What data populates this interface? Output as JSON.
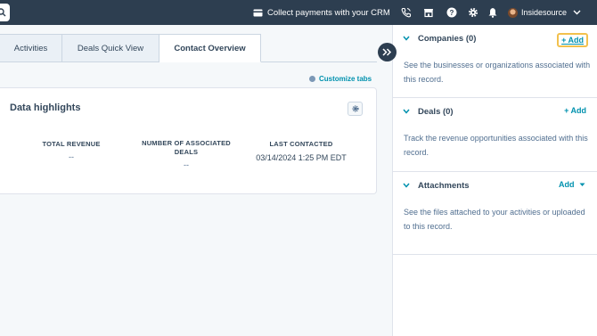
{
  "topbar": {
    "collect_label": "Collect payments with your CRM",
    "account_name": "Insidesource",
    "icons": [
      "search-icon",
      "credit-card-icon",
      "phone-icon",
      "marketplace-icon",
      "help-icon",
      "settings-icon",
      "bell-icon",
      "chevron-down-icon"
    ]
  },
  "tabs": [
    {
      "label": "Activities"
    },
    {
      "label": "Deals Quick View"
    },
    {
      "label": "Contact Overview",
      "active": true
    }
  ],
  "customize_label": "Customize tabs",
  "highlights": {
    "title": "Data highlights",
    "stats": [
      {
        "label": "TOTAL REVENUE",
        "value": "--"
      },
      {
        "label": "NUMBER OF ASSOCIATED DEALS",
        "value": "--"
      },
      {
        "label": "LAST CONTACTED",
        "value": "03/14/2024 1:25 PM EDT"
      }
    ]
  },
  "sidebar": {
    "companies": {
      "title": "Companies (0)",
      "add": "+ Add",
      "desc": "See the businesses or organizations associated with this record."
    },
    "deals": {
      "title": "Deals (0)",
      "add": "+ Add",
      "desc": "Track the revenue opportunities associated with this record."
    },
    "attachments": {
      "title": "Attachments",
      "add": "Add",
      "desc": "See the files attached to your activities or uploaded to this record."
    }
  },
  "colors": {
    "nav_bg": "#2d3e50",
    "link": "#0091ae",
    "highlight": "#f2c14e"
  }
}
